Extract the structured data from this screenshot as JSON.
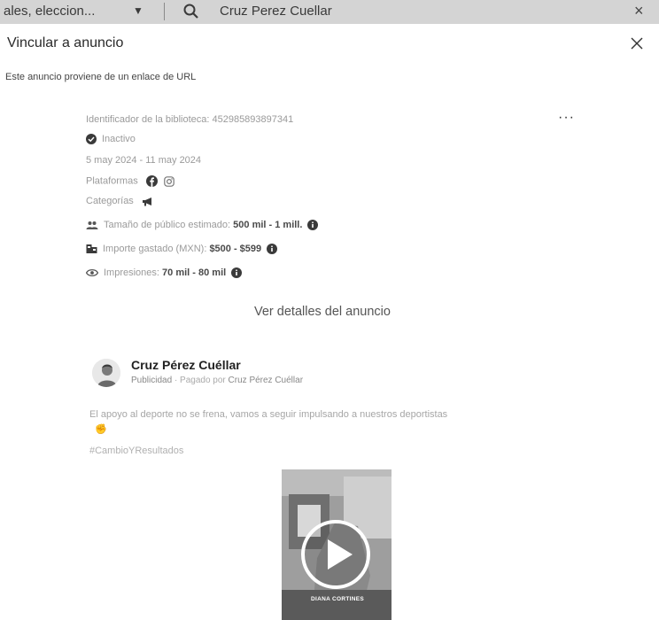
{
  "search": {
    "filter_value": "ales, eleccion...",
    "query": "Cruz Perez Cuellar",
    "clear": "×"
  },
  "modal": {
    "title": "Vincular a anuncio",
    "close": "×",
    "url_note": "Este anuncio proviene de un enlace de URL"
  },
  "ad": {
    "library_id": "Identificador de la biblioteca: 452985893897341",
    "more": "···",
    "status": "Inactivo",
    "dates": "5 may 2024 - 11 may 2024",
    "platforms_label": "Plataformas",
    "categories_label": "Categorías",
    "audience_label": "Tamaño de público estimado:",
    "audience_value": "500 mil - 1 mill.",
    "spend_label": "Importe gastado (MXN):",
    "spend_value": "$500 - $599",
    "impressions_label": "Impresiones:",
    "impressions_value": "70 mil - 80 mil",
    "details_link": "Ver detalles del anuncio"
  },
  "post": {
    "page_name": "Cruz Pérez Cuéllar",
    "sponsored": "Publicidad",
    "paid_by_label": "· Pagado por",
    "paid_by": "Cruz Pérez Cuéllar",
    "text": "El apoyo al deporte no se frena, vamos a seguir impulsando a nuestros deportistas",
    "hashtag": "#CambioYResultados",
    "video_caption": "DIANA CORTINES"
  },
  "icons": {
    "status": "check-circle-icon",
    "platforms": [
      "facebook-icon",
      "instagram-icon"
    ],
    "category": "megaphone-icon",
    "audience": "people-icon",
    "spend": "money-icon",
    "impressions": "eye-icon",
    "info": "info-icon"
  }
}
